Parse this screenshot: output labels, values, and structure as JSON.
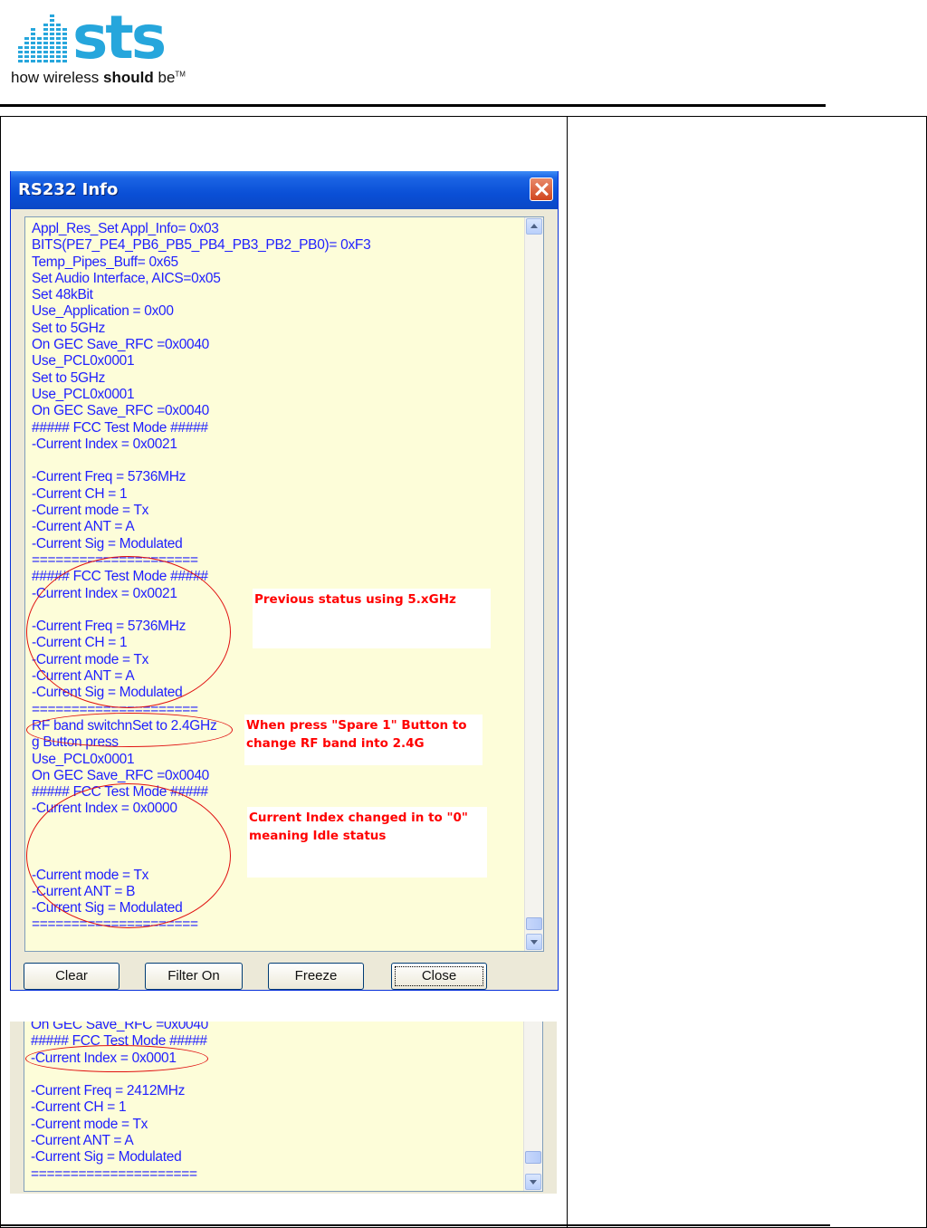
{
  "header": {
    "logo_text": "sts",
    "tagline_regular_1": "how wireless ",
    "tagline_bold": "should",
    "tagline_regular_2": " be",
    "tagline_tm": "TM"
  },
  "window": {
    "title": "RS232 Info",
    "log_lines": [
      "Appl_Res_Set Appl_Info= 0x03",
      "BITS(PE7_PE4_PB6_PB5_PB4_PB3_PB2_PB0)= 0xF3",
      "Temp_Pipes_Buff= 0x65",
      "Set Audio Interface, AICS=0x05",
      "Set 48kBit",
      "Use_Application = 0x00",
      "Set to 5GHz",
      "On GEC Save_RFC =0x0040",
      "Use_PCL0x0001",
      "Set to 5GHz",
      "Use_PCL0x0001",
      "On GEC Save_RFC =0x0040",
      "##### FCC Test Mode #####",
      "-Current Index = 0x0021",
      "",
      "-Current Freq = 5736MHz",
      "-Current CH = 1",
      "-Current mode = Tx",
      "-Current ANT = A",
      "-Current Sig = Modulated",
      "=====================",
      "##### FCC Test Mode #####",
      "-Current Index = 0x0021",
      "",
      "-Current Freq = 5736MHz",
      "-Current CH = 1",
      "-Current mode = Tx",
      "-Current ANT = A",
      "-Current Sig = Modulated",
      "=====================",
      "RF band switchnSet to 2.4GHz",
      "g Button press",
      "Use_PCL0x0001",
      "On GEC Save_RFC =0x0040",
      "##### FCC Test Mode #####",
      "-Current Index = 0x0000",
      "",
      "",
      "",
      "-Current mode = Tx",
      "-Current ANT = B",
      "-Current Sig = Modulated",
      "====================="
    ],
    "buttons": {
      "clear": "Clear",
      "filter": "Filter On",
      "freeze": "Freeze",
      "close": "Close"
    },
    "annotations": {
      "note1": "Previous status using 5.xGHz",
      "note2": "When press \"Spare 1\" Button to\nchange RF band into 2.4G",
      "note3": "Current Index changed in to \"0\"\nmeaning Idle status"
    }
  },
  "window2": {
    "log_lines": [
      "On GEC Save_RFC =0x0040",
      "##### FCC Test Mode #####",
      "-Current Index = 0x0001",
      "",
      "-Current Freq = 2412MHz",
      "-Current CH = 1",
      "-Current mode = Tx",
      "-Current ANT = A",
      "-Current Sig = Modulated",
      "====================="
    ]
  },
  "colors": {
    "log_text": "#1f1fff",
    "log_background": "#fdfdd9",
    "annotation": "#ff0000",
    "titlebar": "#0a4fd6"
  }
}
